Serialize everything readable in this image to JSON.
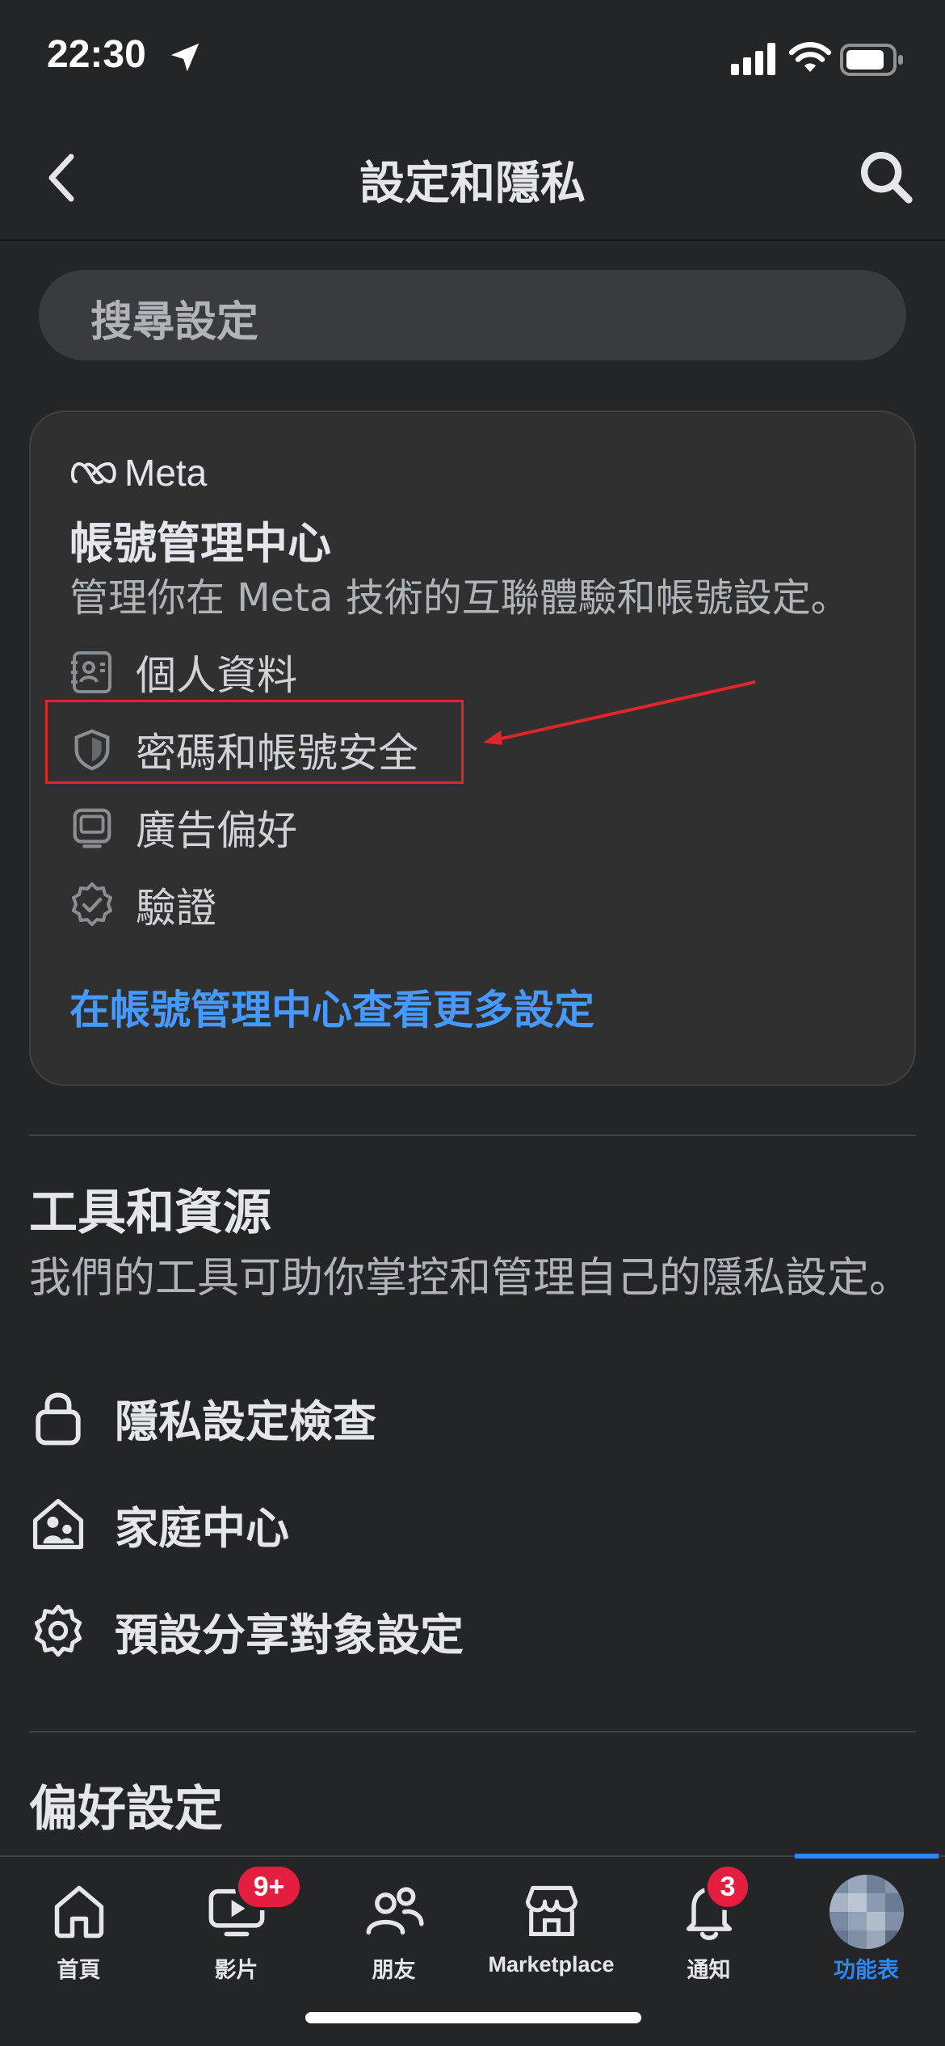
{
  "status": {
    "time": "22:30"
  },
  "header": {
    "title": "設定和隱私"
  },
  "search": {
    "placeholder": "搜尋設定"
  },
  "accounts_center": {
    "brand": "Meta",
    "title": "帳號管理中心",
    "description": "管理你在 Meta 技術的互聯體驗和帳號設定。",
    "items": [
      {
        "label": "個人資料",
        "icon": "id-card-icon"
      },
      {
        "label": "密碼和帳號安全",
        "icon": "shield-icon"
      },
      {
        "label": "廣告偏好",
        "icon": "monitor-icon"
      },
      {
        "label": "驗證",
        "icon": "verified-badge-icon"
      }
    ],
    "see_more": "在帳號管理中心查看更多設定"
  },
  "tools": {
    "title": "工具和資源",
    "description": "我們的工具可助你掌控和管理自己的隱私設定。",
    "items": [
      {
        "label": "隱私設定檢查",
        "icon": "lock-icon"
      },
      {
        "label": "家庭中心",
        "icon": "family-house-icon"
      },
      {
        "label": "預設分享對象設定",
        "icon": "gear-icon"
      }
    ]
  },
  "preferences": {
    "title": "偏好設定"
  },
  "tabbar": {
    "tabs": [
      {
        "label": "首頁",
        "icon": "home-icon"
      },
      {
        "label": "影片",
        "icon": "video-icon",
        "badge": "9+"
      },
      {
        "label": "朋友",
        "icon": "friends-icon"
      },
      {
        "label": "Marketplace",
        "icon": "marketplace-icon"
      },
      {
        "label": "通知",
        "icon": "bell-icon",
        "badge": "3"
      },
      {
        "label": "功能表",
        "icon": "avatar",
        "active": true
      }
    ]
  },
  "colors": {
    "background": "#242526",
    "card": "#303031",
    "accent_blue": "#2d88ff",
    "link_blue": "#4599ff",
    "badge_red": "#e41e3f",
    "annotation_red": "#e0262a"
  }
}
